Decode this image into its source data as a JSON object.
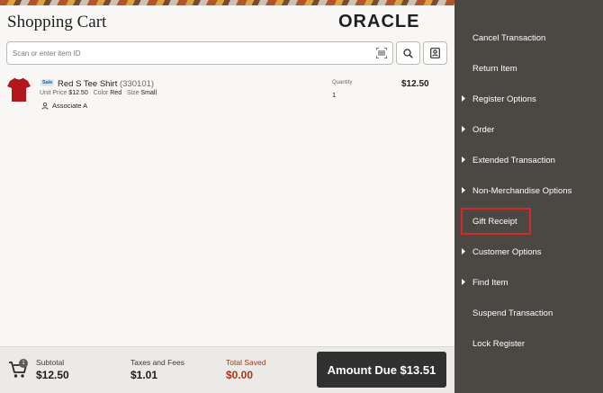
{
  "header": {
    "title": "Shopping Cart",
    "brand": "ORACLE"
  },
  "search": {
    "placeholder": "Scan or enter item ID",
    "icons": [
      "barcode-scan-icon",
      "search-icon",
      "customer-card-icon"
    ]
  },
  "line_items": [
    {
      "badge": "Sale",
      "name": "Red S Tee Shirt",
      "sku": "(330101)",
      "unit_price_label": "Unit Price",
      "unit_price": "$12.50",
      "color_label": "Color",
      "color": "Red",
      "size_label": "Size",
      "size": "Small",
      "associate": "Associate A",
      "quantity_label": "Quantity",
      "quantity": "1",
      "price": "$12.50",
      "thumb_color": "#b3171b"
    }
  ],
  "footer": {
    "cart_count": "1",
    "subtotal_label": "Subtotal",
    "subtotal": "$12.50",
    "taxes_label": "Taxes and Fees",
    "taxes": "$1.01",
    "saved_label": "Total Saved",
    "saved": "$0.00",
    "amount_due": "Amount Due $13.51"
  },
  "side_menu": [
    {
      "label": "Cancel Transaction",
      "chevron": false
    },
    {
      "label": "Return Item",
      "chevron": false
    },
    {
      "label": "Register Options",
      "chevron": true
    },
    {
      "label": "Order",
      "chevron": true
    },
    {
      "label": "Extended Transaction",
      "chevron": true
    },
    {
      "label": "Non-Merchandise Options",
      "chevron": true
    },
    {
      "label": "Gift Receipt",
      "chevron": false,
      "highlighted": true
    },
    {
      "label": "Customer Options",
      "chevron": true
    },
    {
      "label": "Find Item",
      "chevron": true
    },
    {
      "label": "Suspend Transaction",
      "chevron": false
    },
    {
      "label": "Lock Register",
      "chevron": false
    }
  ],
  "colors": {
    "panel_bg": "#4b4743",
    "amount_due_bg": "#313131",
    "saved_text": "#a3361f",
    "highlight_border": "#d62a2a",
    "brand_text": "#1f1f1f"
  }
}
